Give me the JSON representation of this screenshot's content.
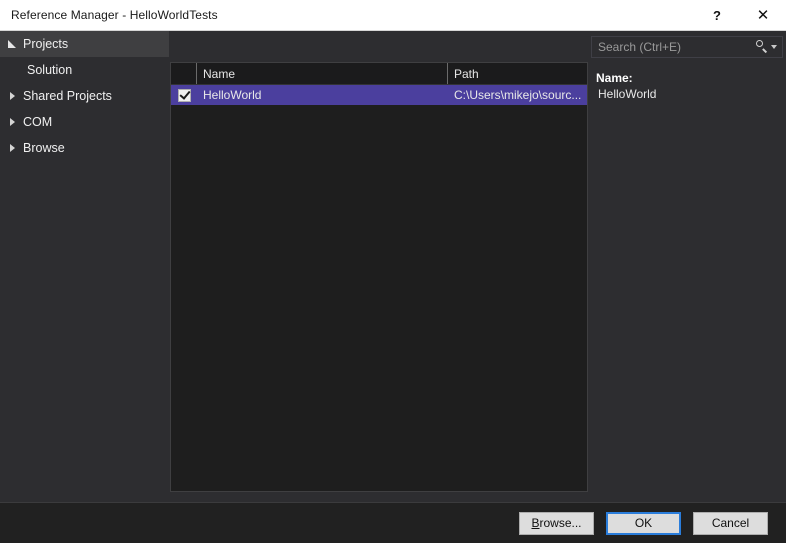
{
  "window": {
    "title": "Reference Manager - HelloWorldTests",
    "help_glyph": "?",
    "close_glyph": "✕"
  },
  "sidebar": {
    "items": [
      {
        "label": "Projects",
        "expander": "expanded",
        "selected": true,
        "level": 0
      },
      {
        "label": "Solution",
        "expander": "none",
        "selected": false,
        "level": 1
      },
      {
        "label": "Shared Projects",
        "expander": "collapsed",
        "selected": false,
        "level": 0
      },
      {
        "label": "COM",
        "expander": "collapsed",
        "selected": false,
        "level": 0
      },
      {
        "label": "Browse",
        "expander": "collapsed",
        "selected": false,
        "level": 0
      }
    ]
  },
  "search": {
    "placeholder": "Search (Ctrl+E)",
    "value": "",
    "icon": "search-icon",
    "dropdown_icon": "chevron-down-icon"
  },
  "list": {
    "columns": [
      {
        "key": "check",
        "label": ""
      },
      {
        "key": "name",
        "label": "Name"
      },
      {
        "key": "path",
        "label": "Path"
      }
    ],
    "rows": [
      {
        "checked": true,
        "name": "HelloWorld",
        "path": "C:\\Users\\mikejo\\sourc...",
        "selected": true
      }
    ]
  },
  "details": {
    "name_label": "Name:",
    "name_value": "HelloWorld"
  },
  "footer": {
    "buttons": [
      {
        "name": "browse-button",
        "prefix": "B",
        "rest": "rowse...",
        "accesskey": true,
        "default": false
      },
      {
        "name": "ok-button",
        "prefix": "",
        "rest": "OK",
        "accesskey": false,
        "default": true
      },
      {
        "name": "cancel-button",
        "prefix": "",
        "rest": "Cancel",
        "accesskey": false,
        "default": false
      }
    ]
  },
  "colors": {
    "selection": "#4b3f9e",
    "titlebar_bg": "#ffffff",
    "sidebar_bg": "#2d2d30",
    "list_bg": "#1e1e1e",
    "footer_bg": "#212121",
    "default_button_border": "#2a7ddb"
  }
}
